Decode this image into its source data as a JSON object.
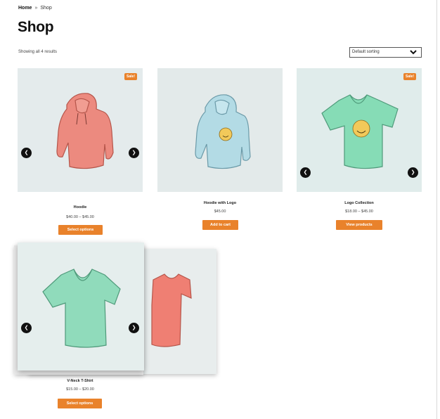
{
  "breadcrumb": {
    "home": "Home",
    "separator": "»",
    "current": "Shop"
  },
  "page": {
    "title": "Shop",
    "result_count": "Showing all 4 results"
  },
  "sorting": {
    "selected": "Default sorting",
    "icon": "chevron-down-icon"
  },
  "products": [
    {
      "name": "Hoodie",
      "price": "$40.00 – $45.00",
      "button": "Select options",
      "badge": "Sale!",
      "image": "pink-hoodie",
      "color": "#e8837a"
    },
    {
      "name": "Hoodie with Logo",
      "price": "$45.00",
      "button": "Add to cart",
      "badge": "",
      "image": "blue-hoodie-logo",
      "color": "#a9d4df"
    },
    {
      "name": "Logo Collection",
      "price": "$18.00 – $45.00",
      "button": "View products",
      "badge": "Sale!",
      "image": "green-tshirt-logo",
      "color": "#7fd6b0"
    },
    {
      "name": "V-Neck T-Shirt",
      "price": "$15.00 – $20.00",
      "button": "Select options",
      "badge": "",
      "image": "green-vneck-tshirt",
      "color": "#8fd9b9"
    }
  ],
  "gallery": {
    "prev_icon": "chevron-left-icon",
    "next_icon": "chevron-right-icon",
    "prev_glyph": "❮",
    "next_glyph": "❯"
  },
  "colors": {
    "accent": "#e9822b",
    "tile_bg": "#e4ebec"
  }
}
